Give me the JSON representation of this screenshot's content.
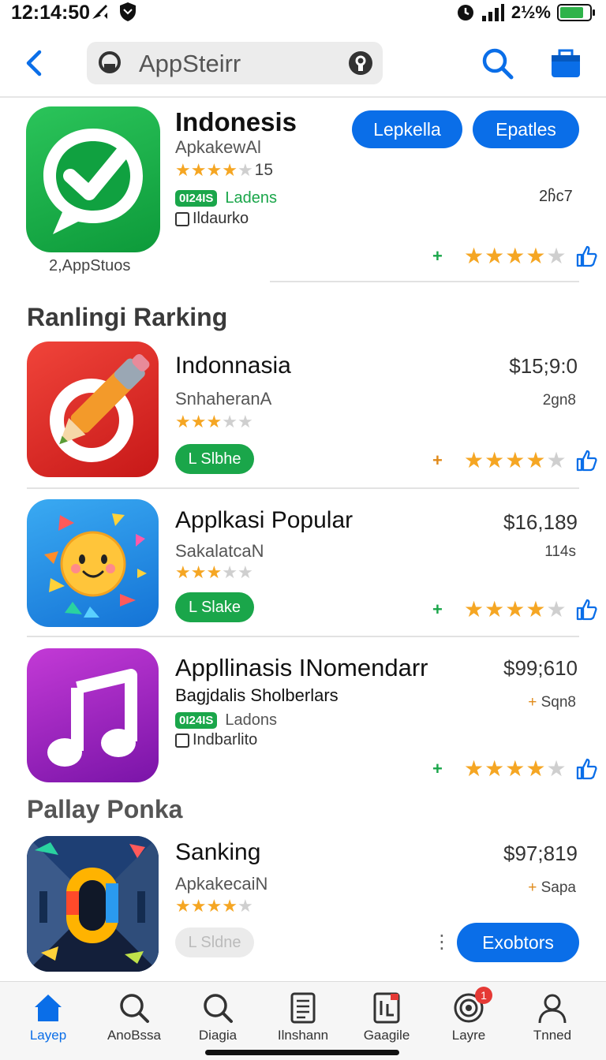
{
  "status_bar": {
    "time": "12:14:50",
    "battery_percent": "2½%",
    "battery_level": 0.8
  },
  "header": {
    "search_text": "AppSteirr"
  },
  "featured": {
    "title": "Indonesis",
    "subtitle": "ApkakewAl",
    "stars": 4,
    "rating_text": "15",
    "badge": "0I24IS",
    "badge_label": "Ladens",
    "check_label": "Ildaurko",
    "caption": "2,AppStuos",
    "button_1": "Lepkella",
    "button_2": "Epatles",
    "size": "2ჩc7",
    "action_stars": 4
  },
  "sections": {
    "ranking_title": "Ranlingi Rarking",
    "popular_title": "Pallay Ponka"
  },
  "apps": [
    {
      "title": "Indonnasia",
      "subtitle": "SnhaheranA",
      "stars": 3,
      "price": "$15;9:0",
      "size": "2gn8",
      "button": "L Slbhe",
      "action_stars": 4
    },
    {
      "title": "Applkasi Popular",
      "subtitle": "SakalatcaN",
      "stars": 3,
      "price": "$16,189",
      "size": "114s",
      "button": "L Slake",
      "action_stars": 4
    },
    {
      "title": "Appllinasis INomendarr",
      "subtitle": "Bagjdalis Sholberlars",
      "badge": "0I24IS",
      "badge_label": "Ladons",
      "check_label": "Indbarlito",
      "price": "$99;610",
      "size": "Sqn8",
      "action_stars": 4
    },
    {
      "title": "Sanking",
      "subtitle": "ApkakecaiN",
      "stars": 4,
      "price": "$97;819",
      "size": "Sapa",
      "button": "L Sldne",
      "action_button": "Exobtors"
    }
  ],
  "tabbar": {
    "tabs": [
      {
        "label": "Layep",
        "icon": "home-icon"
      },
      {
        "label": "AnoBssa",
        "icon": "search-icon"
      },
      {
        "label": "Diagia",
        "icon": "search-icon"
      },
      {
        "label": "Ilnshann",
        "icon": "document-icon"
      },
      {
        "label": "Gaagile",
        "icon": "games-icon"
      },
      {
        "label": "Layre",
        "icon": "updates-icon",
        "badge": "1"
      },
      {
        "label": "Tnned",
        "icon": "person-icon"
      }
    ]
  },
  "colors": {
    "accent": "#0a6ee8",
    "green": "#1aa64a",
    "star": "#f5a623"
  }
}
